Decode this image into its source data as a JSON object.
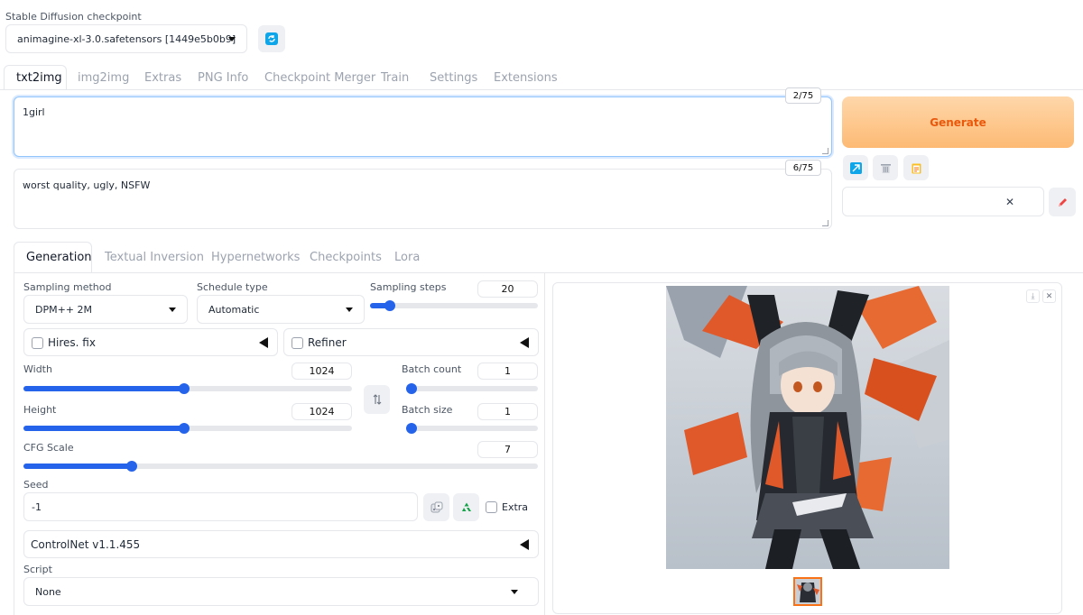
{
  "checkpoint": {
    "label": "Stable Diffusion checkpoint",
    "value": "animagine-xl-3.0.safetensors [1449e5b0b9]"
  },
  "main_tabs": [
    "txt2img",
    "img2img",
    "Extras",
    "PNG Info",
    "Checkpoint Merger",
    "Train",
    "Settings",
    "Extensions"
  ],
  "prompt": {
    "value": "1girl",
    "counter": "2/75"
  },
  "negative_prompt": {
    "value": "worst quality, ugly, NSFW",
    "counter": "6/75"
  },
  "generate_label": "Generate",
  "sub_tabs": [
    "Generation",
    "Textual Inversion",
    "Hypernetworks",
    "Checkpoints",
    "Lora"
  ],
  "sampling_method": {
    "label": "Sampling method",
    "value": "DPM++ 2M"
  },
  "schedule_type": {
    "label": "Schedule type",
    "value": "Automatic"
  },
  "sampling_steps": {
    "label": "Sampling steps",
    "value": "20",
    "fraction": 0.12
  },
  "hires_fix": {
    "label": "Hires. fix"
  },
  "refiner": {
    "label": "Refiner"
  },
  "width": {
    "label": "Width",
    "value": "1024",
    "fraction": 0.49
  },
  "height": {
    "label": "Height",
    "value": "1024",
    "fraction": 0.49
  },
  "batch_count": {
    "label": "Batch count",
    "value": "1",
    "fraction": 0.0
  },
  "batch_size": {
    "label": "Batch size",
    "value": "1",
    "fraction": 0.0
  },
  "cfg_scale": {
    "label": "CFG Scale",
    "value": "7",
    "fraction": 0.21
  },
  "seed": {
    "label": "Seed",
    "value": "-1",
    "extra_label": "Extra"
  },
  "controlnet": {
    "label": "ControlNet v1.1.455"
  },
  "script": {
    "label": "Script",
    "value": "None"
  },
  "colors": {
    "accent": "#2563eb",
    "generate_bg": "#fdba74",
    "generate_text": "#ea580c"
  }
}
